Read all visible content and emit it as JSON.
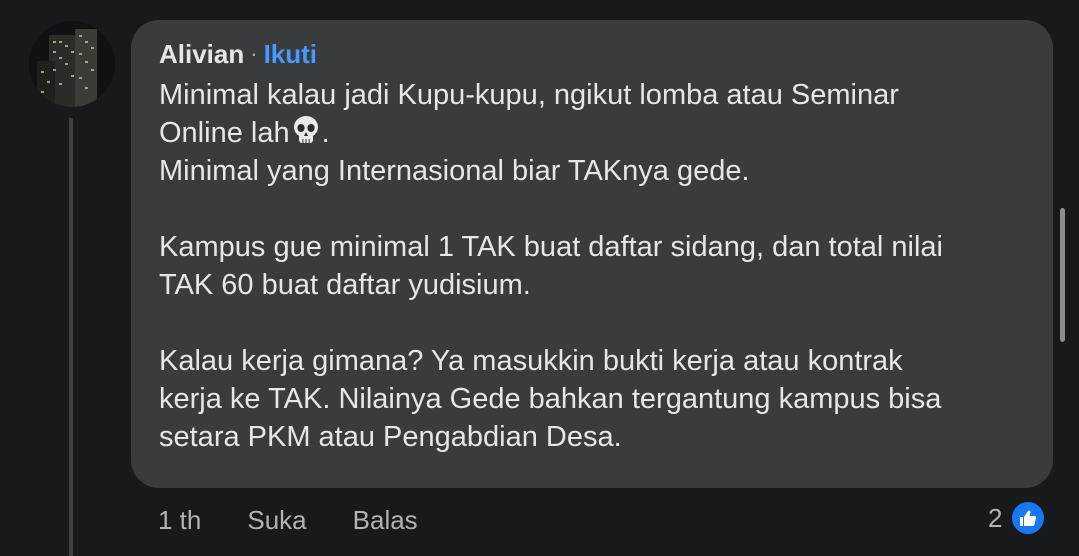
{
  "comment": {
    "author": "Alivian",
    "separator": "·",
    "follow_label": "Ikuti",
    "paragraphs": [
      {
        "lines": [
          "Minimal kalau jadi Kupu-kupu, ngikut lomba atau Seminar",
          "Online lah",
          "Minimal yang Internasional biar TAKnya gede."
        ],
        "line2_suffix": "."
      },
      {
        "lines": [
          "Kampus gue minimal 1 TAK buat daftar sidang, dan total nilai",
          "TAK 60 buat daftar yudisium."
        ]
      },
      {
        "lines": [
          "Kalau kerja gimana? Ya masukkin bukti kerja atau kontrak",
          "kerja ke TAK. Nilainya Gede bahkan tergantung kampus bisa",
          "setara PKM atau Pengabdian Desa."
        ]
      }
    ],
    "emoji": "skull-emoji"
  },
  "actions": {
    "time": "1 th",
    "like_label": "Suka",
    "reply_label": "Balas"
  },
  "reactions": {
    "count": "2",
    "icon": "thumbs-up-icon",
    "badge_color": "#1877f2"
  },
  "colors": {
    "background": "#18191a",
    "bubble": "#3a3b3c",
    "link": "#4599ff"
  }
}
